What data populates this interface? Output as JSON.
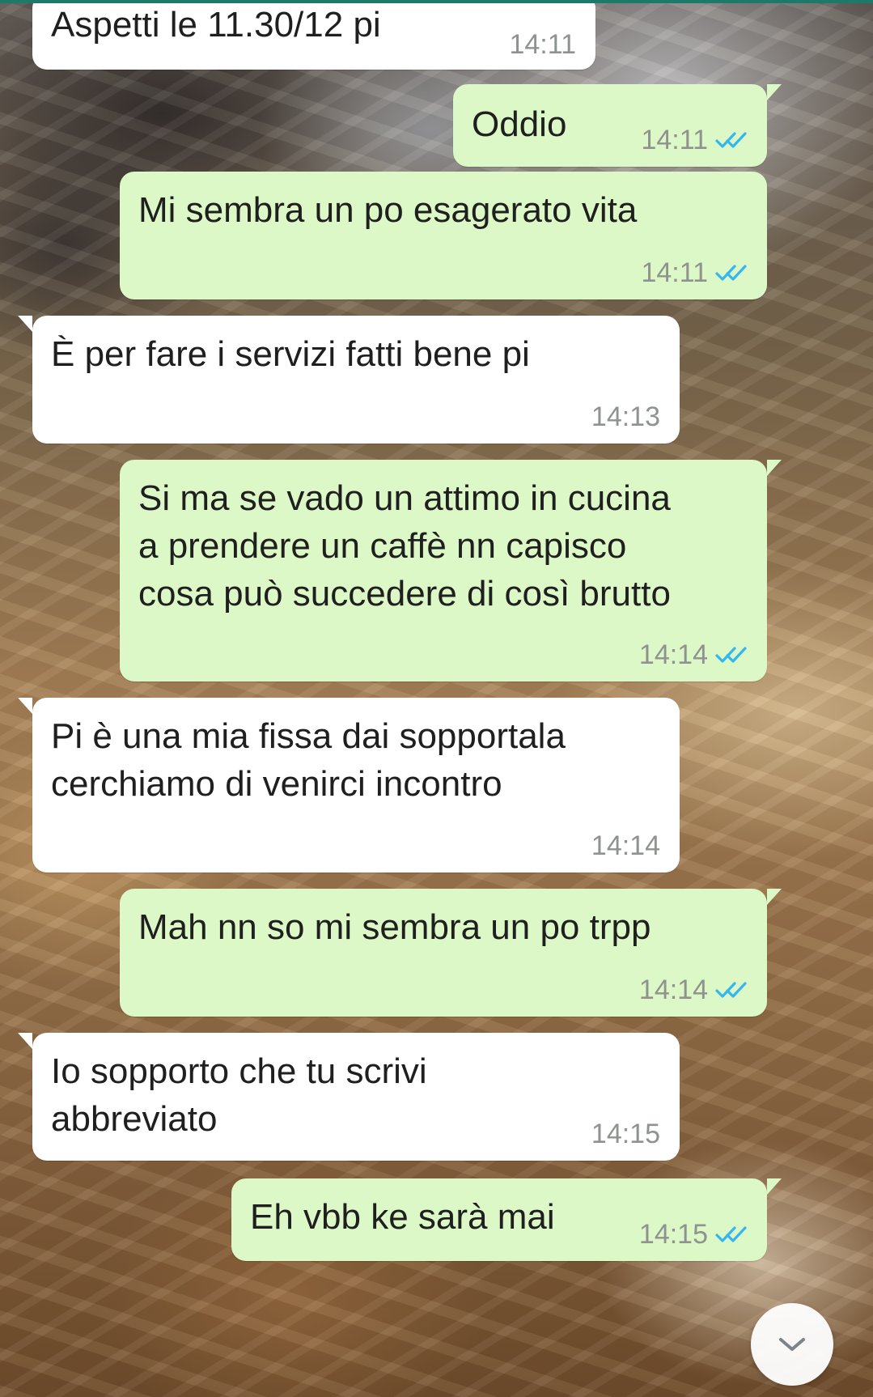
{
  "chat": {
    "messages": [
      {
        "direction": "in",
        "text": "Aspetti le 11.30/12 pi",
        "time": "14:11"
      },
      {
        "direction": "out",
        "text": "Oddio",
        "time": "14:11",
        "status": "read"
      },
      {
        "direction": "out",
        "text": "Mi sembra un po esagerato vita",
        "time": "14:11",
        "status": "read"
      },
      {
        "direction": "in",
        "text": "È per fare i servizi fatti bene pi",
        "time": "14:13"
      },
      {
        "direction": "out",
        "text": "Si ma se vado un attimo in cucina\na prendere un caffè nn capisco\ncosa può succedere di così brutto",
        "time": "14:14",
        "status": "read"
      },
      {
        "direction": "in",
        "text": "Pi è una mia fissa dai sopportala\ncerchiamo di venirci incontro",
        "time": "14:14"
      },
      {
        "direction": "out",
        "text": "Mah nn so mi sembra un po trpp",
        "time": "14:14",
        "status": "read"
      },
      {
        "direction": "in",
        "text": "Io sopporto che tu scrivi\nabbreviato",
        "time": "14:15"
      },
      {
        "direction": "out",
        "text": "Eh vbb ke sarà mai",
        "time": "14:15",
        "status": "read"
      }
    ]
  },
  "icons": {
    "read_receipt": "double-check-icon",
    "scroll_down": "chevron-down-icon"
  },
  "colors": {
    "incoming_bubble": "#ffffff",
    "outgoing_bubble": "#dcf8c6",
    "read_receipt": "#34b7f1",
    "timestamp": "#8f9390"
  }
}
